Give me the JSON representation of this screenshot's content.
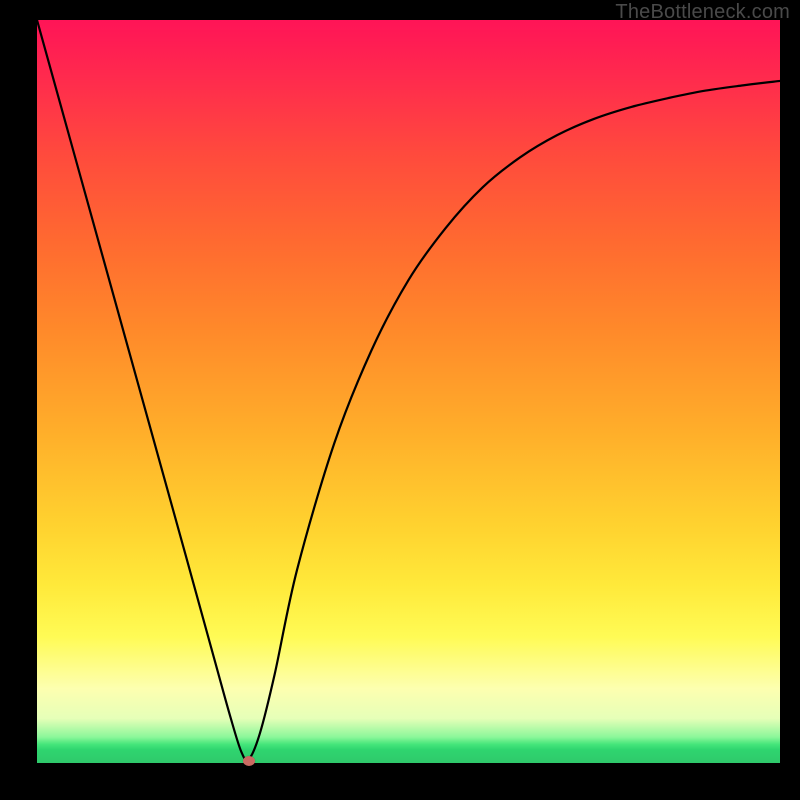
{
  "watermark": "TheBottleneck.com",
  "chart_data": {
    "type": "line",
    "title": "",
    "xlabel": "",
    "ylabel": "",
    "xlim": [
      0,
      1
    ],
    "ylim": [
      0,
      1
    ],
    "series": [
      {
        "name": "bottleneck-curve",
        "x": [
          0.0,
          0.05,
          0.1,
          0.15,
          0.2,
          0.24,
          0.26,
          0.275,
          0.285,
          0.3,
          0.32,
          0.35,
          0.4,
          0.45,
          0.5,
          0.55,
          0.6,
          0.65,
          0.7,
          0.75,
          0.8,
          0.85,
          0.9,
          0.95,
          1.0
        ],
        "y": [
          1.0,
          0.82,
          0.64,
          0.46,
          0.28,
          0.135,
          0.063,
          0.015,
          0.005,
          0.04,
          0.12,
          0.26,
          0.43,
          0.555,
          0.65,
          0.72,
          0.775,
          0.815,
          0.845,
          0.867,
          0.883,
          0.895,
          0.905,
          0.912,
          0.918
        ]
      }
    ],
    "annotations": [
      {
        "name": "min-marker",
        "x": 0.285,
        "y": 0.003
      }
    ]
  },
  "colors": {
    "curve": "#000000",
    "marker": "#cb6a62",
    "frame_bg": "#000000"
  }
}
